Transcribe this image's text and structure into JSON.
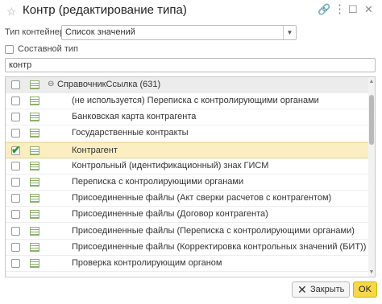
{
  "window": {
    "title": "Контр (редактирование типа)"
  },
  "form": {
    "type_label": "Тип контейнера:",
    "type_value": "Список значений",
    "composite_label": "Составной тип",
    "composite_checked": false,
    "search_value": "контр"
  },
  "list": {
    "group": "СправочникСсылка (631)",
    "items": [
      {
        "label": "(не используется) Переписка с контролирующими органами",
        "checked": false
      },
      {
        "label": "Банковская карта контрагента",
        "checked": false
      },
      {
        "label": "Государственные контракты",
        "checked": false
      },
      {
        "label": "Контрагент",
        "checked": true
      },
      {
        "label": "Контрольный (идентификационный) знак ГИСМ",
        "checked": false
      },
      {
        "label": "Переписка с контролирующими органами",
        "checked": false
      },
      {
        "label": "Присоединенные файлы (Акт сверки расчетов с контрагентом)",
        "checked": false
      },
      {
        "label": "Присоединенные файлы (Договор контрагента)",
        "checked": false
      },
      {
        "label": "Присоединенные файлы (Переписка с контролирующими органами)",
        "checked": false
      },
      {
        "label": "Присоединенные файлы (Корректировка контрольных значений (БИТ))",
        "checked": false
      },
      {
        "label": "Проверка контролирующим органом",
        "checked": false
      }
    ]
  },
  "buttons": {
    "close": "Закрыть",
    "ok": "OK"
  },
  "colors": {
    "selected_row": "#fbeec1",
    "ok_button": "#f6d74a",
    "checkmark": "#2a9a2a"
  }
}
